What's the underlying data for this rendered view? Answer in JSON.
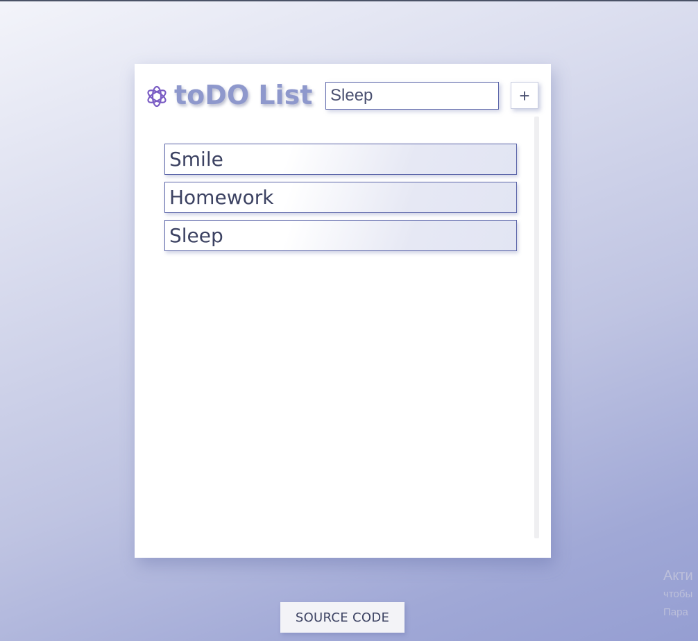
{
  "app": {
    "title": "toDO List",
    "logo_icon": "react-logo-icon",
    "accent_color": "#8e98cc"
  },
  "new_task": {
    "value": "Sleep",
    "add_label": "+"
  },
  "todos": [
    {
      "label": "Smile"
    },
    {
      "label": "Homework"
    },
    {
      "label": "Sleep"
    }
  ],
  "footer": {
    "source_label": "SOURCE CODE"
  },
  "os_watermark": {
    "title": "Акти",
    "line1": "чтобы",
    "line2": "Пара"
  }
}
